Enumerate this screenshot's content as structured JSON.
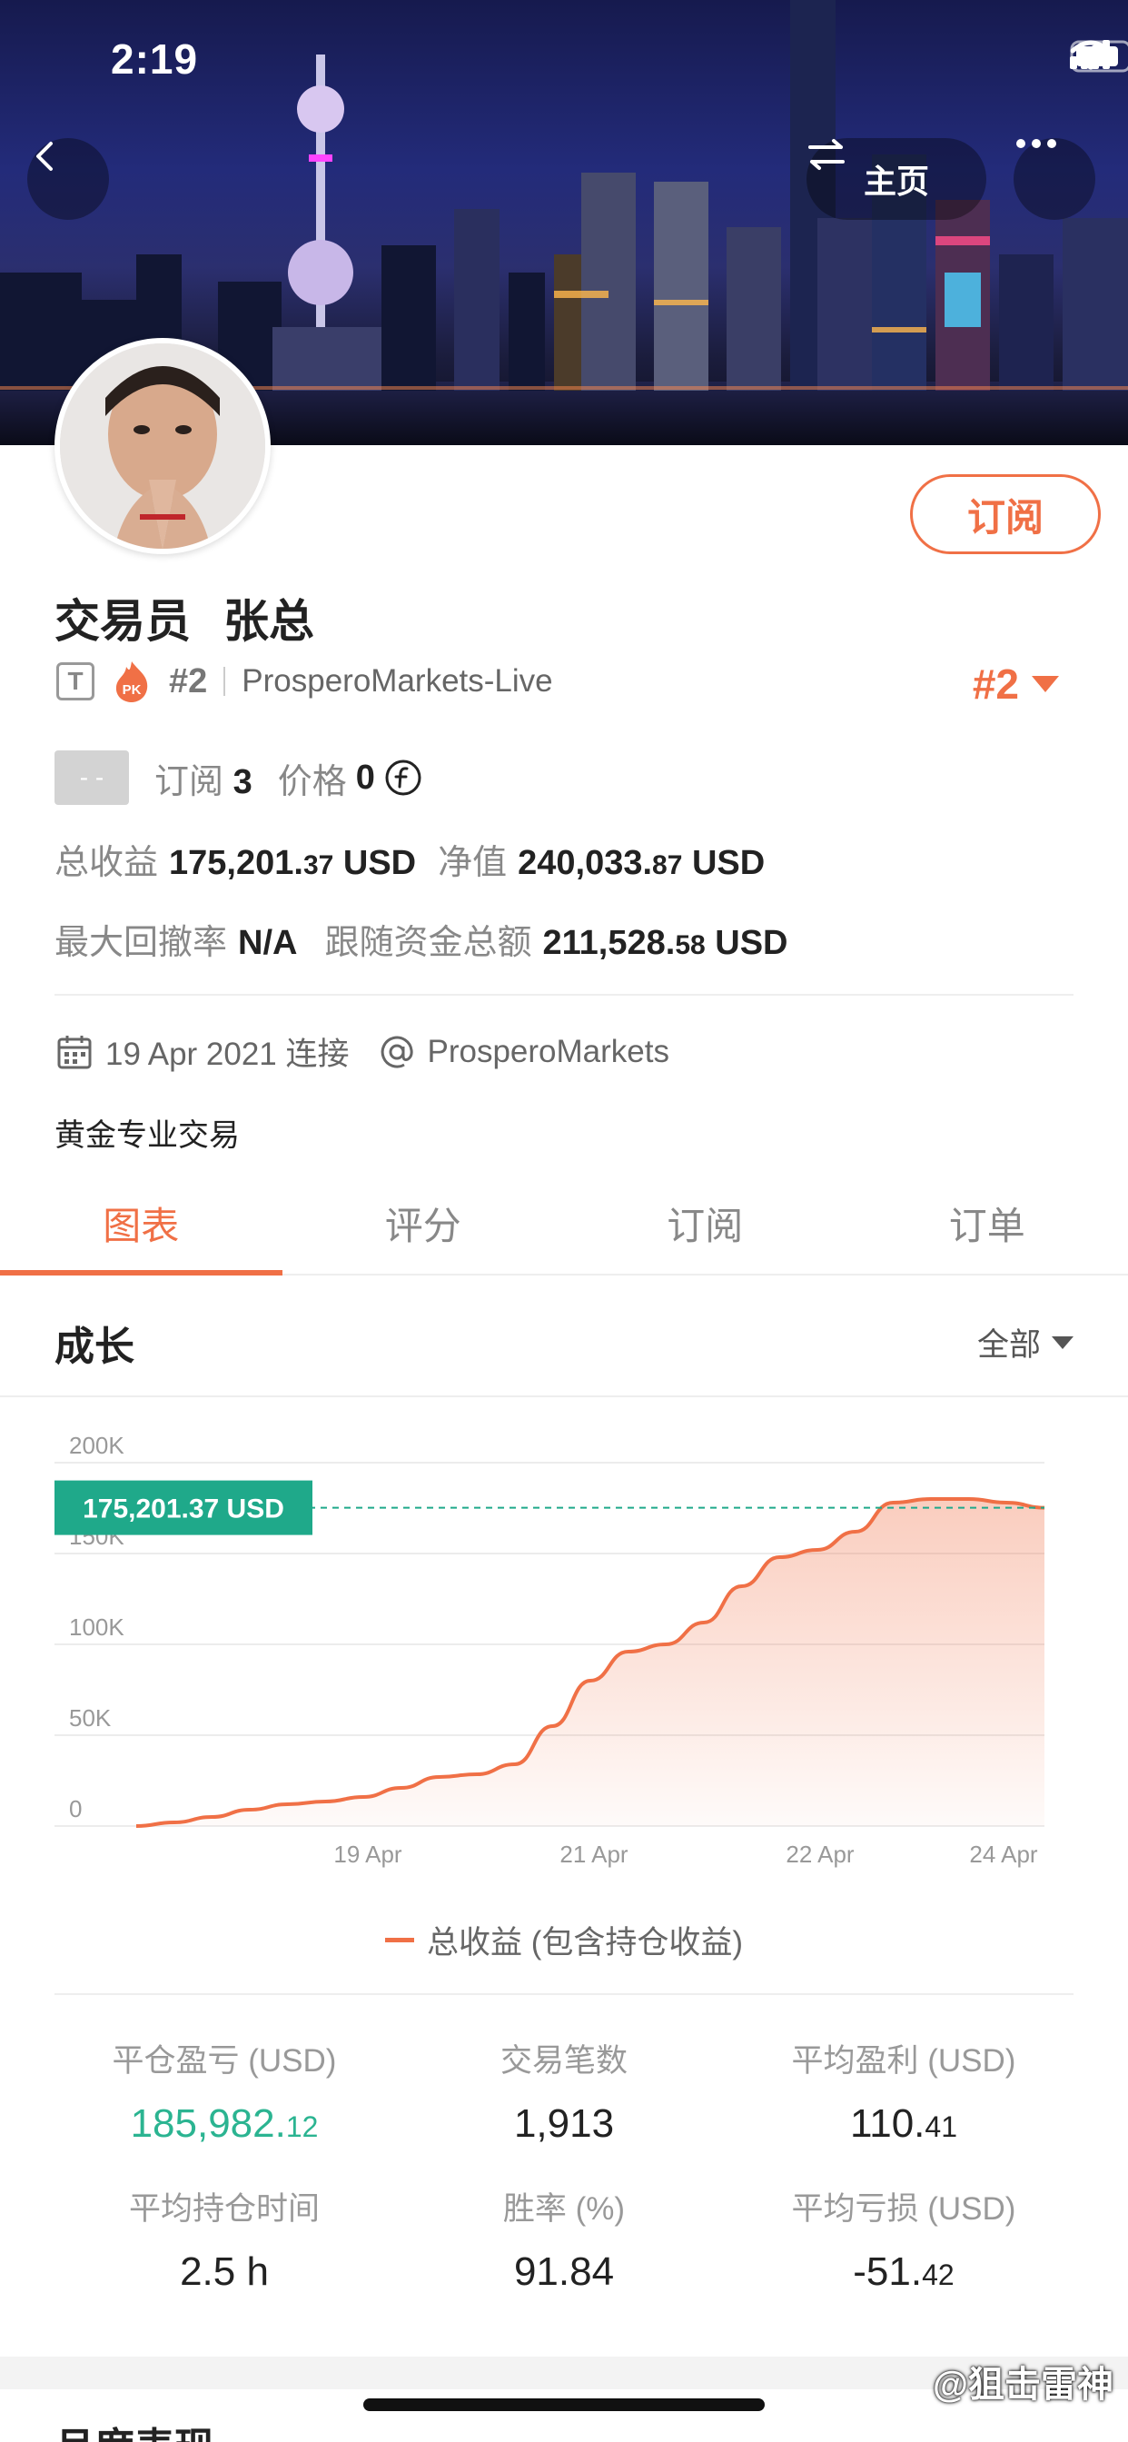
{
  "status": {
    "time": "2:19"
  },
  "header": {
    "home_label": "主页"
  },
  "profile": {
    "subscribe_label": "订阅",
    "role": "交易员",
    "name": "张总",
    "t_badge": "T",
    "pk_badge": "PK",
    "rank": "#2",
    "account": "ProsperoMarkets-Live",
    "rank_right": "#2",
    "chip_text": "- -",
    "subscriptions_label": "订阅",
    "subscriptions_value": "3",
    "price_label": "价格",
    "price_value": "0",
    "total_profit_label": "总收益",
    "total_profit_main": "175,201.",
    "total_profit_dec": "37",
    "total_profit_unit": "USD",
    "net_value_label": "净值",
    "net_value_main": "240,033.",
    "net_value_dec": "87",
    "net_value_unit": "USD",
    "max_drawdown_label": "最大回撤率",
    "max_drawdown_value": "N/A",
    "follow_total_label": "跟随资金总额",
    "follow_total_main": "211,528.",
    "follow_total_dec": "58",
    "follow_total_unit": "USD",
    "connected_date": "19 Apr 2021 连接",
    "broker": "ProsperoMarkets",
    "bio": "黄金专业交易"
  },
  "tabs": [
    {
      "label": "图表",
      "active": true
    },
    {
      "label": "评分",
      "active": false
    },
    {
      "label": "订阅",
      "active": false
    },
    {
      "label": "订单",
      "active": false
    }
  ],
  "growth": {
    "title": "成长",
    "filter": "全部"
  },
  "chart_data": {
    "type": "area",
    "ylim": [
      0,
      200000
    ],
    "y_ticks": [
      "200K",
      "150K",
      "100K",
      "50K",
      "0"
    ],
    "x_ticks": [
      "19 Apr",
      "21 Apr",
      "22 Apr",
      "24 Apr"
    ],
    "current_label": "175,201.37 USD",
    "current_value": 175201.37,
    "legend": "总收益 (包含持仓收益)",
    "accent_color": "#f07046",
    "label_color": "#1fa98a",
    "series": [
      {
        "name": "总收益 (包含持仓收益)",
        "values": [
          0,
          2000,
          5000,
          9000,
          12000,
          13500,
          16000,
          21000,
          27000,
          28500,
          34000,
          55000,
          80000,
          96000,
          100000,
          112000,
          132000,
          148000,
          152000,
          162000,
          178000,
          180000,
          180000,
          178000,
          175201.37
        ]
      }
    ]
  },
  "metrics": [
    {
      "label": "平仓盈亏 (USD)",
      "main": "185,982.",
      "dec": "12",
      "green": true
    },
    {
      "label": "交易笔数",
      "main": "1,913",
      "dec": "",
      "green": false
    },
    {
      "label": "平均盈利 (USD)",
      "main": "110.",
      "dec": "41",
      "green": false
    },
    {
      "label": "平均持仓时间",
      "main": "2.5 h",
      "dec": "",
      "green": false
    },
    {
      "label": "胜率 (%)",
      "main": "91.84",
      "dec": "",
      "green": false
    },
    {
      "label": "平均亏损 (USD)",
      "main": "-51.",
      "dec": "42",
      "green": false
    }
  ],
  "bottom_section_title": "月度表现",
  "watermark": "@狙击雷神"
}
